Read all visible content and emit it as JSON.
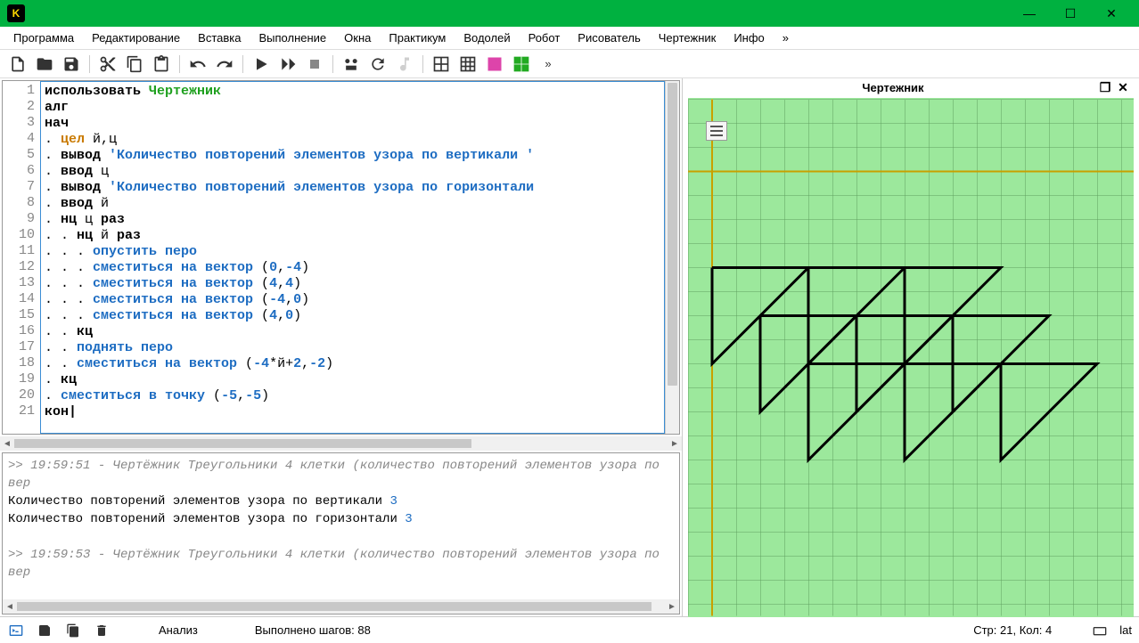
{
  "window": {
    "logo": "K"
  },
  "menu": {
    "items": [
      "Программа",
      "Редактирование",
      "Вставка",
      "Выполнение",
      "Окна",
      "Практикум",
      "Водолей",
      "Робот",
      "Рисователь",
      "Чертежник",
      "Инфо",
      "»"
    ]
  },
  "toolbar_more": "»",
  "editor": {
    "lines": [
      {
        "n": 1,
        "tokens": [
          {
            "t": "использовать",
            "c": "kw-use"
          },
          {
            "t": " "
          },
          {
            "t": "Чертежник",
            "c": "kw-mod"
          }
        ]
      },
      {
        "n": 2,
        "tokens": [
          {
            "t": "алг",
            "c": "kw"
          }
        ]
      },
      {
        "n": 3,
        "tokens": [
          {
            "t": "нач",
            "c": "kw"
          }
        ]
      },
      {
        "n": 4,
        "tokens": [
          {
            "t": ". "
          },
          {
            "t": "цел",
            "c": "kw-type"
          },
          {
            "t": " й,ц"
          }
        ]
      },
      {
        "n": 5,
        "tokens": [
          {
            "t": ". "
          },
          {
            "t": "вывод",
            "c": "kw"
          },
          {
            "t": " "
          },
          {
            "t": "'Количество повторений элементов узора по вертикали '",
            "c": "str"
          }
        ]
      },
      {
        "n": 6,
        "tokens": [
          {
            "t": ". "
          },
          {
            "t": "ввод",
            "c": "kw"
          },
          {
            "t": " ц"
          }
        ]
      },
      {
        "n": 7,
        "tokens": [
          {
            "t": ". "
          },
          {
            "t": "вывод",
            "c": "kw"
          },
          {
            "t": " "
          },
          {
            "t": "'Количество повторений элементов узора по горизонтали",
            "c": "str"
          }
        ]
      },
      {
        "n": 8,
        "tokens": [
          {
            "t": ". "
          },
          {
            "t": "ввод",
            "c": "kw"
          },
          {
            "t": " й"
          }
        ]
      },
      {
        "n": 9,
        "tokens": [
          {
            "t": ". "
          },
          {
            "t": "нц",
            "c": "kw"
          },
          {
            "t": " ц "
          },
          {
            "t": "раз",
            "c": "kw"
          }
        ]
      },
      {
        "n": 10,
        "tokens": [
          {
            "t": ". . "
          },
          {
            "t": "нц",
            "c": "kw"
          },
          {
            "t": " й "
          },
          {
            "t": "раз",
            "c": "kw"
          }
        ]
      },
      {
        "n": 11,
        "tokens": [
          {
            "t": ". . . "
          },
          {
            "t": "опустить перо",
            "c": "kw-cmd"
          }
        ]
      },
      {
        "n": 12,
        "tokens": [
          {
            "t": ". . . "
          },
          {
            "t": "сместиться на вектор",
            "c": "kw-cmd"
          },
          {
            "t": " ("
          },
          {
            "t": "0",
            "c": "num"
          },
          {
            "t": ","
          },
          {
            "t": "-4",
            "c": "num"
          },
          {
            "t": ")"
          }
        ]
      },
      {
        "n": 13,
        "tokens": [
          {
            "t": ". . . "
          },
          {
            "t": "сместиться на вектор",
            "c": "kw-cmd"
          },
          {
            "t": " ("
          },
          {
            "t": "4",
            "c": "num"
          },
          {
            "t": ","
          },
          {
            "t": "4",
            "c": "num"
          },
          {
            "t": ")"
          }
        ]
      },
      {
        "n": 14,
        "tokens": [
          {
            "t": ". . . "
          },
          {
            "t": "сместиться на вектор",
            "c": "kw-cmd"
          },
          {
            "t": " ("
          },
          {
            "t": "-4",
            "c": "num"
          },
          {
            "t": ","
          },
          {
            "t": "0",
            "c": "num"
          },
          {
            "t": ")"
          }
        ]
      },
      {
        "n": 15,
        "tokens": [
          {
            "t": ". . . "
          },
          {
            "t": "сместиться на вектор",
            "c": "kw-cmd"
          },
          {
            "t": " ("
          },
          {
            "t": "4",
            "c": "num"
          },
          {
            "t": ","
          },
          {
            "t": "0",
            "c": "num"
          },
          {
            "t": ")"
          }
        ]
      },
      {
        "n": 16,
        "tokens": [
          {
            "t": ". . "
          },
          {
            "t": "кц",
            "c": "kw"
          }
        ]
      },
      {
        "n": 17,
        "tokens": [
          {
            "t": ". . "
          },
          {
            "t": "поднять перо",
            "c": "kw-cmd"
          }
        ]
      },
      {
        "n": 18,
        "tokens": [
          {
            "t": ". . "
          },
          {
            "t": "сместиться на вектор",
            "c": "kw-cmd"
          },
          {
            "t": " ("
          },
          {
            "t": "-4",
            "c": "num"
          },
          {
            "t": "*й+"
          },
          {
            "t": "2",
            "c": "num"
          },
          {
            "t": ","
          },
          {
            "t": "-2",
            "c": "num"
          },
          {
            "t": ")"
          }
        ]
      },
      {
        "n": 19,
        "tokens": [
          {
            "t": ". "
          },
          {
            "t": "кц",
            "c": "kw"
          }
        ]
      },
      {
        "n": 20,
        "tokens": [
          {
            "t": ". "
          },
          {
            "t": "сместиться в точку",
            "c": "kw-cmd"
          },
          {
            "t": " ("
          },
          {
            "t": "-5",
            "c": "num"
          },
          {
            "t": ","
          },
          {
            "t": "-5",
            "c": "num"
          },
          {
            "t": ")"
          }
        ]
      },
      {
        "n": 21,
        "tokens": [
          {
            "t": "кон",
            "c": "kw"
          },
          {
            "t": "|",
            "c": "op"
          }
        ]
      }
    ]
  },
  "console": {
    "lines": [
      {
        "type": "meta",
        "text": ">> 19:59:51 - Чертёжник Треугольники 4 клетки (количество повторений элементов узора по вер"
      },
      {
        "type": "io",
        "prefix": "Количество повторений элементов узора по вертикали ",
        "val": "3"
      },
      {
        "type": "io",
        "prefix": "Количество повторений элементов узора по горизонтали ",
        "val": "3"
      },
      {
        "type": "blank"
      },
      {
        "type": "meta",
        "text": ">> 19:59:53 - Чертёжник Треугольники 4 клетки (количество повторений элементов узора по вер"
      }
    ]
  },
  "canvas": {
    "title": "Чертежник"
  },
  "status": {
    "analysis": "Анализ",
    "steps": "Выполнено шагов: 88",
    "pos": "Стр: 21, Кол: 4",
    "lang": "lat"
  }
}
